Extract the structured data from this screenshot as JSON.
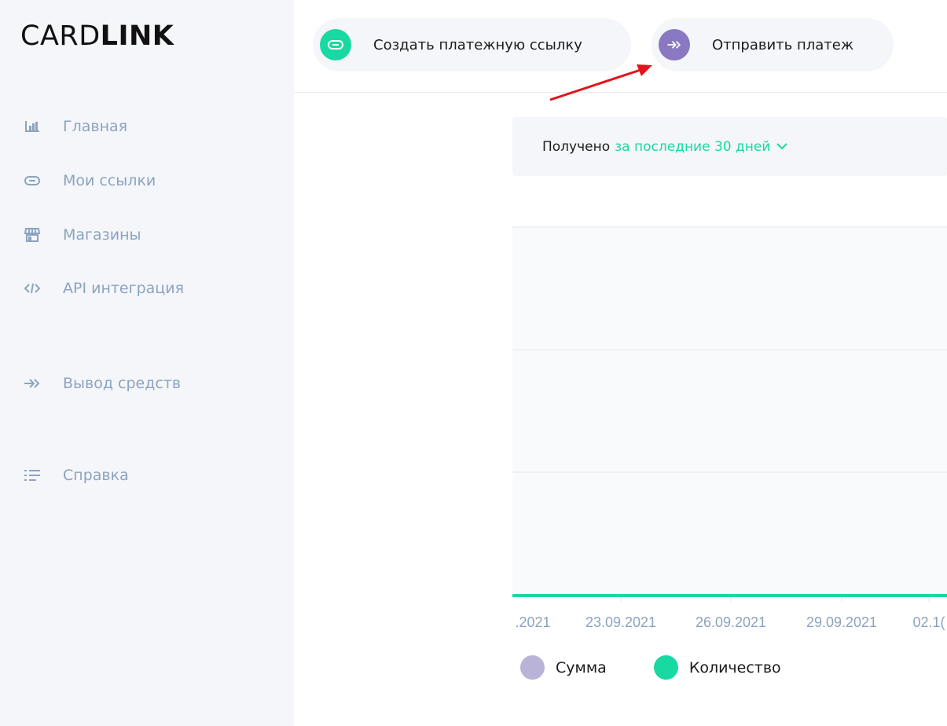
{
  "logo": {
    "part1": "CARD",
    "part2": "LINK"
  },
  "sidebar": {
    "items": [
      {
        "label": "Главная",
        "icon": "bar-chart-icon"
      },
      {
        "label": "Мои ссылки",
        "icon": "link-icon"
      },
      {
        "label": "Магазины",
        "icon": "store-icon"
      },
      {
        "label": "API интеграция",
        "icon": "code-icon"
      },
      {
        "label": "Вывод средств",
        "icon": "double-arrow-right-icon"
      },
      {
        "label": "Справка",
        "icon": "list-icon"
      }
    ]
  },
  "header": {
    "create_link_label": "Создать платежную ссылку",
    "send_payment_label": "Отправить платеж"
  },
  "filter": {
    "static_label": "Получено",
    "period_label": "за последние 30 дней"
  },
  "colors": {
    "accent_green": "#19d9a2",
    "accent_purple": "#8a78c2",
    "sidebar_text": "#8da3bf",
    "legend_sum": "#bab3d8",
    "legend_count": "#19d9a2",
    "annotation_arrow": "#e3141b"
  },
  "chart_data": {
    "type": "line",
    "x": [
      ".2021",
      "23.09.2021",
      "26.09.2021",
      "29.09.2021",
      "02.1("
    ],
    "series": [
      {
        "name": "Сумма",
        "values": [
          0,
          0,
          0,
          0,
          0
        ]
      },
      {
        "name": "Количество",
        "values": [
          0,
          0,
          0,
          0,
          0
        ]
      }
    ],
    "legend": [
      "Сумма",
      "Количество"
    ],
    "grid": true
  }
}
